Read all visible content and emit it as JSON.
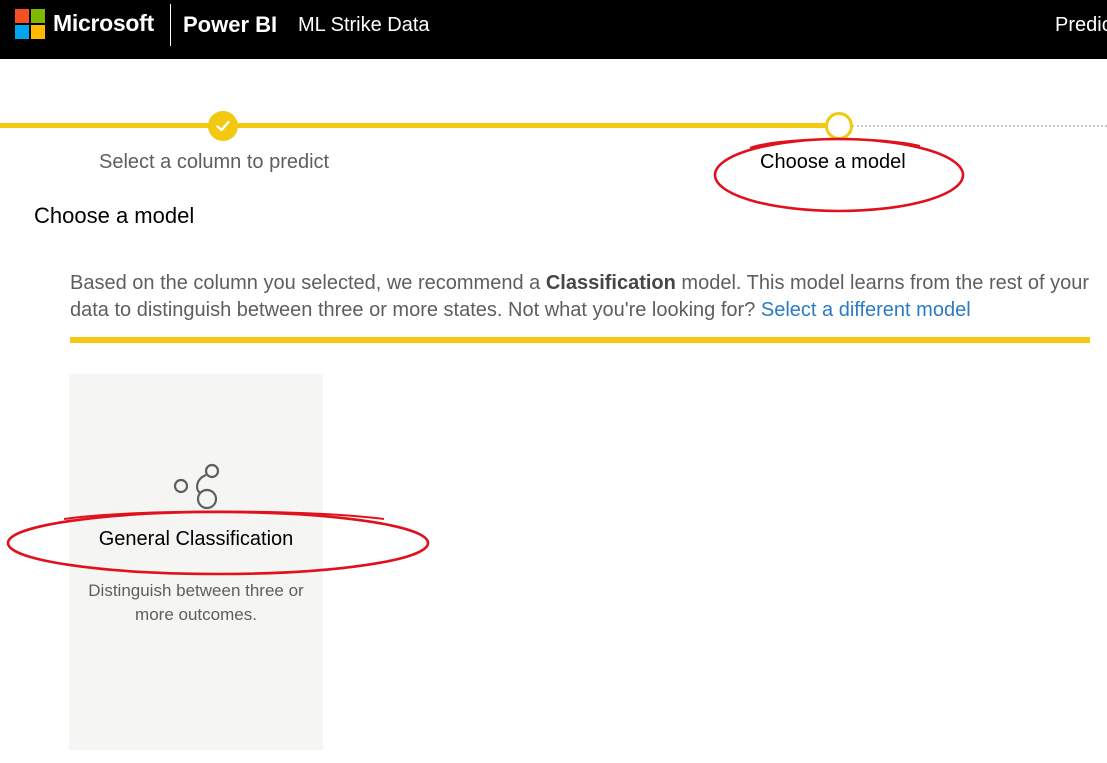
{
  "header": {
    "brand": "Microsoft",
    "product": "Power BI",
    "workspace": "ML Strike Data",
    "right_text": "Predic"
  },
  "stepper": {
    "steps": [
      {
        "label": "Select a column to predict",
        "status": "completed"
      },
      {
        "label": "Choose a model",
        "status": "current"
      }
    ]
  },
  "main": {
    "heading": "Choose a model",
    "description": {
      "before": "Based on the column you selected, we recommend a ",
      "bold": "Classification",
      "after": " model. This model learns from the rest of your data to distinguish between three or more states. Not what you're looking for? ",
      "link": "Select a different model"
    }
  },
  "model_card": {
    "icon": "classification-bubbles-icon",
    "title": "General Classification",
    "description": "Distinguish between three or more outcomes."
  },
  "colors": {
    "accent": "#f2c811",
    "link": "#2b7bc3",
    "annotation": "#e0101c",
    "topbar": "#000000"
  }
}
